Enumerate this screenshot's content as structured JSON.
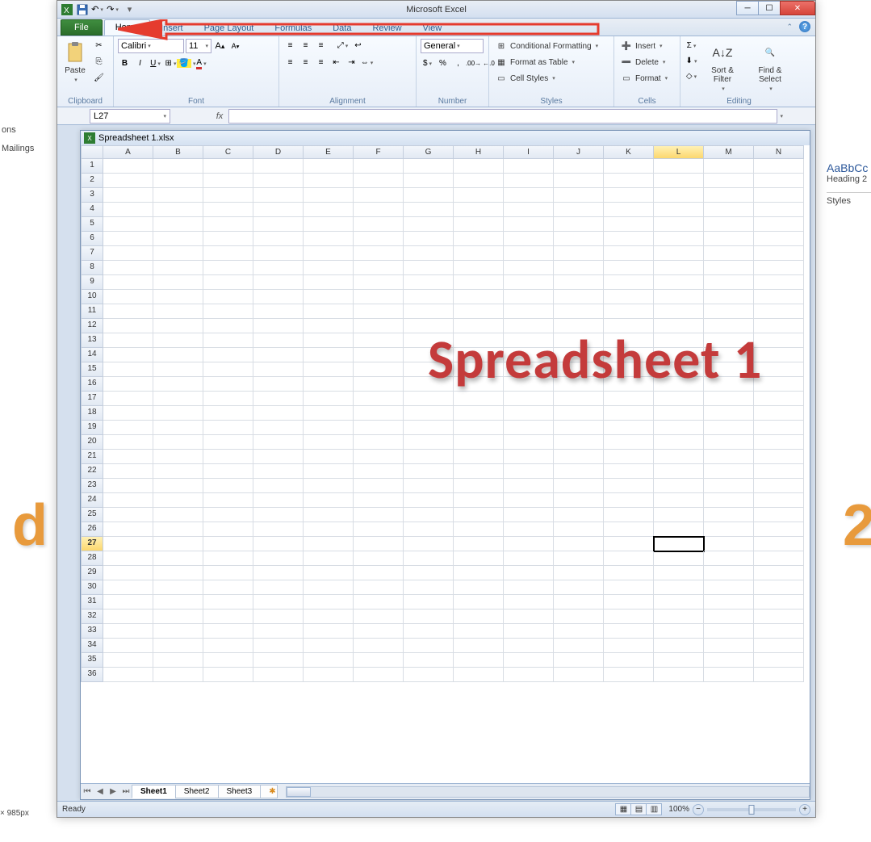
{
  "app_title": "Microsoft Excel",
  "qat": {
    "save": "💾",
    "undo": "↶",
    "redo": "↷"
  },
  "tabs": {
    "file": "File",
    "home": "Home",
    "insert": "Insert",
    "pagelayout": "Page Layout",
    "formulas": "Formulas",
    "data": "Data",
    "review": "Review",
    "view": "View"
  },
  "ribbon": {
    "clipboard": {
      "label": "Clipboard",
      "paste": "Paste"
    },
    "font": {
      "label": "Font",
      "name": "Calibri",
      "size": "11"
    },
    "alignment": {
      "label": "Alignment"
    },
    "number": {
      "label": "Number",
      "format": "General"
    },
    "styles": {
      "label": "Styles",
      "cond": "Conditional Formatting",
      "table": "Format as Table",
      "cell": "Cell Styles"
    },
    "cells": {
      "label": "Cells",
      "insert": "Insert",
      "delete": "Delete",
      "format": "Format"
    },
    "editing": {
      "label": "Editing",
      "sort": "Sort & Filter",
      "find": "Find & Select"
    }
  },
  "namebox": "L27",
  "workbook_title": "Spreadsheet 1.xlsx",
  "columns": [
    "A",
    "B",
    "C",
    "D",
    "E",
    "F",
    "G",
    "H",
    "I",
    "J",
    "K",
    "L",
    "M",
    "N"
  ],
  "selected_col": "L",
  "rows": [
    1,
    2,
    3,
    4,
    5,
    6,
    7,
    8,
    9,
    10,
    11,
    12,
    13,
    14,
    15,
    16,
    17,
    18,
    19,
    20,
    21,
    22,
    23,
    24,
    25,
    26,
    27,
    28,
    29,
    30,
    31,
    32,
    33,
    34,
    35,
    36
  ],
  "selected_row": 27,
  "sheets": {
    "s1": "Sheet1",
    "s2": "Sheet2",
    "s3": "Sheet3"
  },
  "status": {
    "ready": "Ready",
    "zoom": "100%"
  },
  "overlay": "Spreadsheet 1",
  "bg": {
    "heading2": "Heading 2",
    "aabbcc": "AaBbCc",
    "styles": "Styles",
    "dimpx": "× 985px",
    "ons": "ons",
    "mailings": "Mailings"
  }
}
